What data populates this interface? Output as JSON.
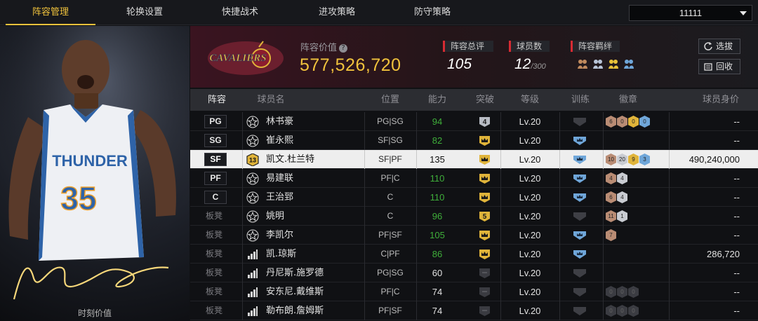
{
  "nav": {
    "tabs": [
      {
        "label": "阵容管理",
        "active": true
      },
      {
        "label": "轮换设置",
        "active": false
      },
      {
        "label": "快捷战术",
        "active": false
      },
      {
        "label": "进攻策略",
        "active": false
      },
      {
        "label": "防守策略",
        "active": false
      }
    ],
    "team_selector_value": "11111"
  },
  "card": {
    "jersey_text": "THUNDER",
    "jersey_number": "35",
    "caption": "时刻价值"
  },
  "header": {
    "logo_text": "CAVALIERS",
    "value_label": "阵容价值",
    "lineup_value": "577,526,720",
    "stats": {
      "rating_label": "阵容总评",
      "rating": "105",
      "count_label": "球员数",
      "count": "12",
      "count_max": "/300",
      "chem_label": "阵容羁绊"
    },
    "buttons": {
      "select": "选拔",
      "recall": "回收"
    }
  },
  "table": {
    "headers": [
      "阵容",
      "球员名",
      "位置",
      "能力",
      "突破",
      "等级",
      "训练",
      "徽章",
      "球员身价"
    ],
    "rows": [
      {
        "slot": "PG",
        "starter": true,
        "type": "star",
        "name": "林书豪",
        "pos": "PG|SG",
        "ability": "94",
        "ability_green": true,
        "break": "4",
        "break_kind": "num",
        "level": "Lv.20",
        "train": "dim",
        "badges": [
          [
            "6",
            "bronze"
          ],
          [
            "0",
            "bronze"
          ],
          [
            "0",
            "gold"
          ],
          [
            "0",
            "blue"
          ]
        ],
        "value": "--",
        "highlight": false
      },
      {
        "slot": "SG",
        "starter": true,
        "type": "star",
        "name": "崔永熙",
        "pos": "SF|SG",
        "ability": "82",
        "ability_green": true,
        "break": "",
        "break_kind": "crown",
        "level": "Lv.20",
        "train": "blue",
        "badges": [],
        "value": "--",
        "highlight": false
      },
      {
        "slot": "SF",
        "starter": true,
        "type": "num13",
        "name": "凯文.杜兰特",
        "pos": "SF|PF",
        "ability": "135",
        "ability_green": false,
        "break": "",
        "break_kind": "crown",
        "level": "Lv.20",
        "train": "blue",
        "badges": [
          [
            "10",
            "bronze"
          ],
          [
            "20",
            "silver"
          ],
          [
            "9",
            "gold"
          ],
          [
            "3",
            "blue"
          ]
        ],
        "value": "490,240,000",
        "highlight": true
      },
      {
        "slot": "PF",
        "starter": true,
        "type": "star",
        "name": "易建联",
        "pos": "PF|C",
        "ability": "110",
        "ability_green": true,
        "break": "",
        "break_kind": "crown",
        "level": "Lv.20",
        "train": "blue",
        "badges": [
          [
            "4",
            "bronze"
          ],
          [
            "4",
            "silver"
          ]
        ],
        "value": "--",
        "highlight": false
      },
      {
        "slot": "C",
        "starter": true,
        "type": "star",
        "name": "王治郅",
        "pos": "C",
        "ability": "110",
        "ability_green": true,
        "break": "",
        "break_kind": "crown",
        "level": "Lv.20",
        "train": "blue",
        "badges": [
          [
            "6",
            "bronze"
          ],
          [
            "4",
            "silver"
          ]
        ],
        "value": "--",
        "highlight": false
      },
      {
        "slot": "板凳",
        "starter": false,
        "type": "star",
        "name": "姚明",
        "pos": "C",
        "ability": "96",
        "ability_green": true,
        "break": "5",
        "break_kind": "num",
        "level": "Lv.20",
        "train": "dim",
        "badges": [
          [
            "11",
            "bronze"
          ],
          [
            "1",
            "silver"
          ]
        ],
        "value": "--",
        "highlight": false
      },
      {
        "slot": "板凳",
        "starter": false,
        "type": "star",
        "name": "李凯尔",
        "pos": "PF|SF",
        "ability": "105",
        "ability_green": true,
        "break": "",
        "break_kind": "crown",
        "level": "Lv.20",
        "train": "blue",
        "badges": [
          [
            "7",
            "bronze"
          ]
        ],
        "value": "--",
        "highlight": false
      },
      {
        "slot": "板凳",
        "starter": false,
        "type": "bars",
        "name": "凯.琼斯",
        "pos": "C|PF",
        "ability": "86",
        "ability_green": true,
        "break": "",
        "break_kind": "crown",
        "level": "Lv.20",
        "train": "blue",
        "badges": [],
        "value": "286,720",
        "highlight": false
      },
      {
        "slot": "板凳",
        "starter": false,
        "type": "bars",
        "name": "丹尼斯.施罗德",
        "pos": "PG|SG",
        "ability": "60",
        "ability_green": false,
        "break": "",
        "break_kind": "dim",
        "level": "Lv.20",
        "train": "dim",
        "badges": [],
        "value": "--",
        "highlight": false
      },
      {
        "slot": "板凳",
        "starter": false,
        "type": "bars",
        "name": "安东尼.戴维斯",
        "pos": "PF|C",
        "ability": "74",
        "ability_green": false,
        "break": "",
        "break_kind": "dim",
        "level": "Lv.20",
        "train": "dim",
        "badges": [
          [
            "0",
            "dim"
          ],
          [
            "0",
            "dim"
          ],
          [
            "0",
            "dim"
          ]
        ],
        "value": "--",
        "highlight": false
      },
      {
        "slot": "板凳",
        "starter": false,
        "type": "bars",
        "name": "勒布朗.詹姆斯",
        "pos": "PF|SF",
        "ability": "74",
        "ability_green": false,
        "break": "",
        "break_kind": "dim",
        "level": "Lv.20",
        "train": "dim",
        "badges": [
          [
            "0",
            "dim"
          ],
          [
            "0",
            "dim"
          ],
          [
            "0",
            "dim"
          ]
        ],
        "value": "--",
        "highlight": false
      }
    ]
  },
  "colors": {
    "accent": "#f0c23c",
    "ability_green": "#3fae3a",
    "highlight_row": "#eeeeee",
    "stat_marker": "#d62b33"
  }
}
